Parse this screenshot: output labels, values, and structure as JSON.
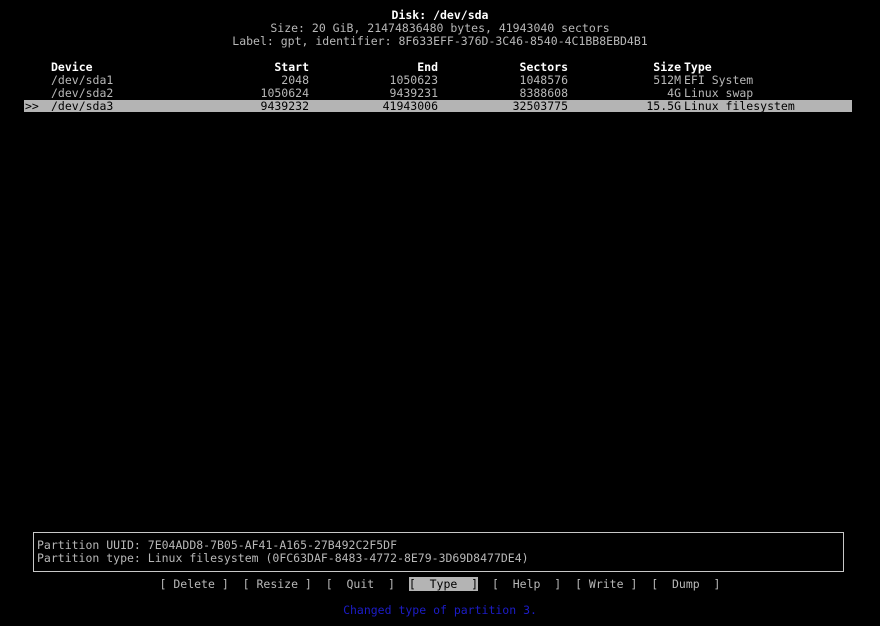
{
  "header": {
    "disk": "Disk: /dev/sda",
    "size": "Size: 20 GiB, 21474836480 bytes, 41943040 sectors",
    "label": "Label: gpt, identifier: 8F633EFF-376D-3C46-8540-4C1BB8EBD4B1"
  },
  "table": {
    "columns": [
      "Device",
      "Start",
      "End",
      "Sectors",
      "Size",
      "Type"
    ],
    "rows": [
      {
        "device": "/dev/sda1",
        "start": "2048",
        "end": "1050623",
        "sectors": "1048576",
        "size": "512M",
        "type": "EFI System"
      },
      {
        "device": "/dev/sda2",
        "start": "1050624",
        "end": "9439231",
        "sectors": "8388608",
        "size": "4G",
        "type": "Linux swap"
      },
      {
        "device": "/dev/sda3",
        "start": "9439232",
        "end": "41943006",
        "sectors": "32503775",
        "size": "15.5G",
        "type": "Linux filesystem"
      }
    ],
    "cursor": ">>",
    "selected_index": 2
  },
  "info": {
    "uuid": "Partition UUID: 7E04ADD8-7B05-AF41-A165-27B492C2F5DF",
    "type": "Partition type: Linux filesystem (0FC63DAF-8483-4772-8E79-3D69D8477DE4)"
  },
  "menu": [
    "[ Delete ]",
    "[ Resize ]",
    "[  Quit  ]",
    "[  Type  ]",
    "[  Help  ]",
    "[ Write ]",
    "[  Dump  ]"
  ],
  "menu_active": 3,
  "status": "Changed type of partition 3.",
  "colors": {
    "background": "#000000",
    "text": "#b8b8b8",
    "highlight": "#b4b4b4",
    "status": "#1c1cc8"
  }
}
